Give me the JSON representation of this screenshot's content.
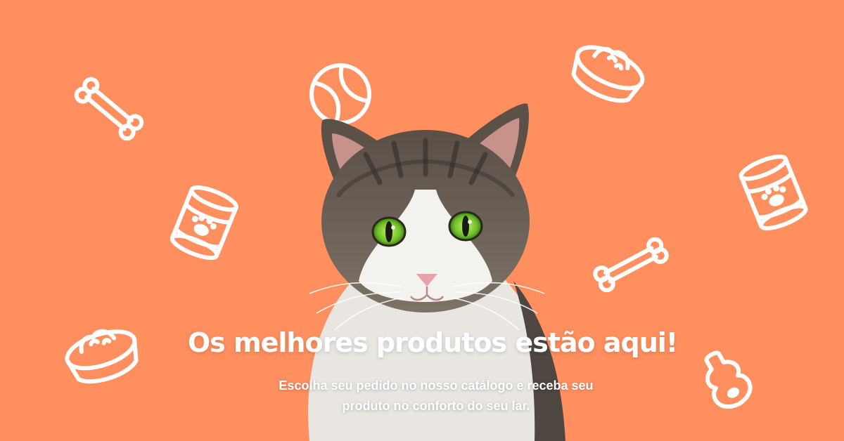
{
  "banner": {
    "headline": "Os melhores produtos estão aqui!",
    "subline_1": "Escolha seu pedido no nosso catálogo e receba seu",
    "subline_2": "produto no conforto do seu lar.",
    "colors": {
      "background": "#ff8f5e",
      "icons": "#ffffff",
      "text": "#ffffff"
    },
    "decorations": [
      "bone-icon",
      "tennis-ball-icon",
      "food-bowl-icon",
      "pet-food-can-icon",
      "pet-food-can-icon",
      "bone-icon",
      "food-bowl-icon",
      "chew-toy-icon"
    ],
    "photo": "tabby-cat-with-white-chest-and-green-eyes"
  }
}
